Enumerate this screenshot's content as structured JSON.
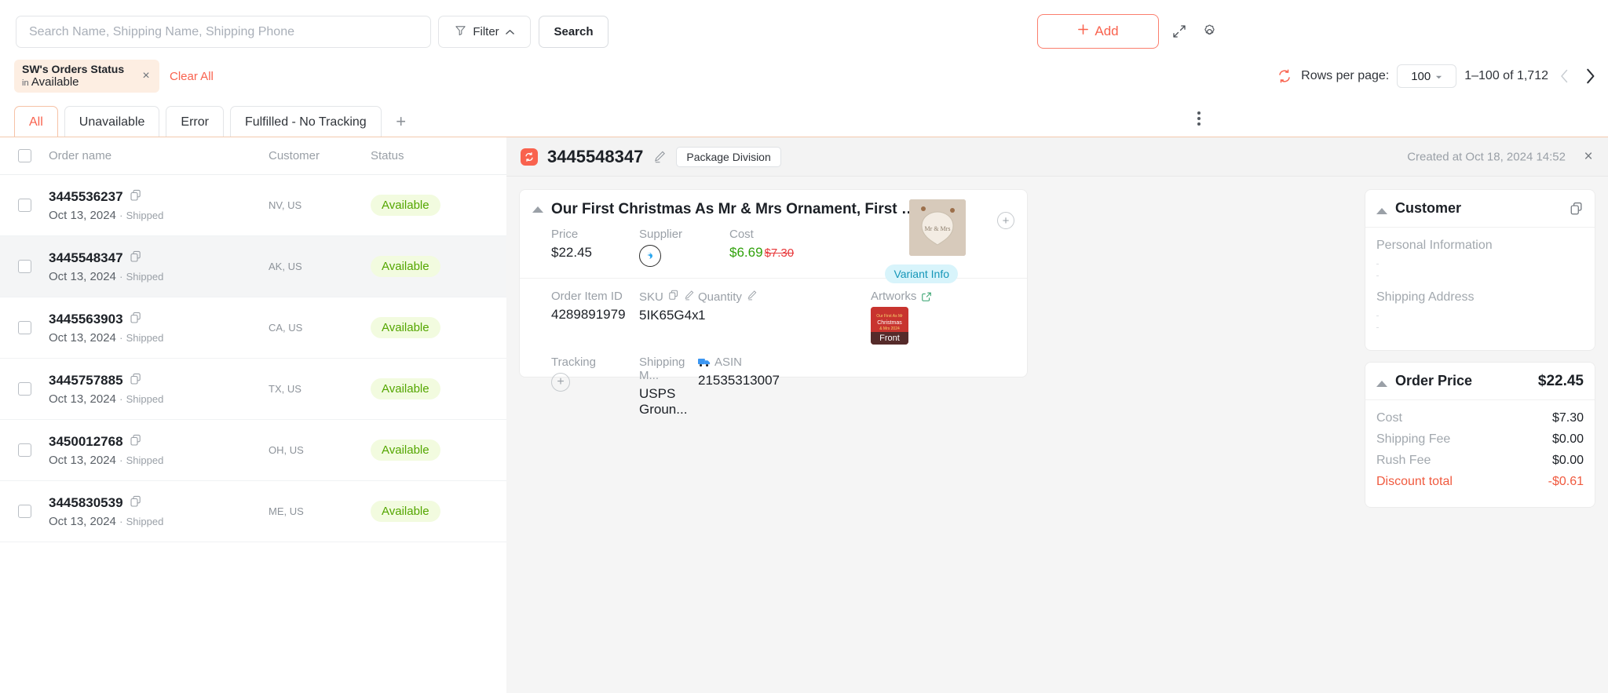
{
  "search": {
    "placeholder": "Search Name, Shipping Name, Shipping Phone",
    "value": ""
  },
  "toolbar": {
    "filter_label": "Filter",
    "search_label": "Search",
    "add_label": "Add",
    "expand_icon": "expand-icon",
    "gear_icon": "gear-icon"
  },
  "filter_chip": {
    "title": "SW's Orders Status",
    "prefix": "in",
    "value": "Available",
    "close": "×",
    "clear_all": "Clear All"
  },
  "pagination": {
    "refresh_icon": "refresh-icon",
    "rows_per_page_label": "Rows per page:",
    "rows_per_page_value": "100",
    "range": "1–100 of 1,712",
    "prev": "‹",
    "next": "›"
  },
  "tabs": {
    "items": [
      {
        "label": "All",
        "active": true
      },
      {
        "label": "Unavailable",
        "active": false
      },
      {
        "label": "Error",
        "active": false
      },
      {
        "label": "Fulfilled - No Tracking",
        "active": false
      }
    ],
    "add": "+"
  },
  "table": {
    "columns": [
      "Order name",
      "Customer",
      "Status"
    ],
    "rows": [
      {
        "order": "3445536237",
        "date": "Oct 13, 2024",
        "sep": "·",
        "ship": "Shipped",
        "customer": "NV, US",
        "status": "Available",
        "selected": false
      },
      {
        "order": "3445548347",
        "date": "Oct 13, 2024",
        "sep": "·",
        "ship": "Shipped",
        "customer": "AK, US",
        "status": "Available",
        "selected": true
      },
      {
        "order": "3445563903",
        "date": "Oct 13, 2024",
        "sep": "·",
        "ship": "Shipped",
        "customer": "CA, US",
        "status": "Available",
        "selected": false
      },
      {
        "order": "3445757885",
        "date": "Oct 13, 2024",
        "sep": "·",
        "ship": "Shipped",
        "customer": "TX, US",
        "status": "Available",
        "selected": false
      },
      {
        "order": "3450012768",
        "date": "Oct 13, 2024",
        "sep": "·",
        "ship": "Shipped",
        "customer": "OH, US",
        "status": "Available",
        "selected": false
      },
      {
        "order": "3445830539",
        "date": "Oct 13, 2024",
        "sep": "·",
        "ship": "Shipped",
        "customer": "ME, US",
        "status": "Available",
        "selected": false
      }
    ]
  },
  "detail": {
    "order_id": "3445548347",
    "package_division": "Package Division",
    "created_at": "Created at Oct 18, 2024 14:52",
    "close": "×",
    "product": {
      "title": "Our First Christmas As Mr & Mrs Ornament, First Married ...",
      "price_label": "Price",
      "price_value": "$22.45",
      "supplier_label": "Supplier",
      "cost_label": "Cost",
      "cost_value": "$6.69",
      "cost_old": "$7.30",
      "variant_info": "Variant Info",
      "order_item_id_label": "Order Item ID",
      "order_item_id_value": "4289891979",
      "sku_label": "SKU",
      "sku_value": "5IK65G4x",
      "quantity_label": "Quantity",
      "quantity_value": "1",
      "artworks_label": "Artworks",
      "artwork_tag": "Front",
      "tracking_label": "Tracking",
      "shipping_method_label": "Shipping M...",
      "shipping_method_value": "USPS Groun...",
      "asin_label": "ASIN",
      "asin_value": "21535313007"
    },
    "customer": {
      "title": "Customer",
      "personal_information": "Personal Information",
      "shipping_address": "Shipping Address"
    },
    "order_price": {
      "title": "Order Price",
      "total": "$22.45",
      "rows": [
        {
          "key": "Cost",
          "value": "$7.30",
          "discount": false
        },
        {
          "key": "Shipping Fee",
          "value": "$0.00",
          "discount": false
        },
        {
          "key": "Rush Fee",
          "value": "$0.00",
          "discount": false
        },
        {
          "key": "Discount total",
          "value": "-$0.61",
          "discount": true
        }
      ]
    }
  },
  "colors": {
    "accent": "#f9624e",
    "chip_bg": "#fdeee2",
    "status_green": "#54a600",
    "status_bg": "#f2fbdf",
    "cost_green": "#2fa10a",
    "cost_strike": "#e8393b",
    "variant_bg": "#d8f4fb",
    "variant_fg": "#1596b8"
  }
}
